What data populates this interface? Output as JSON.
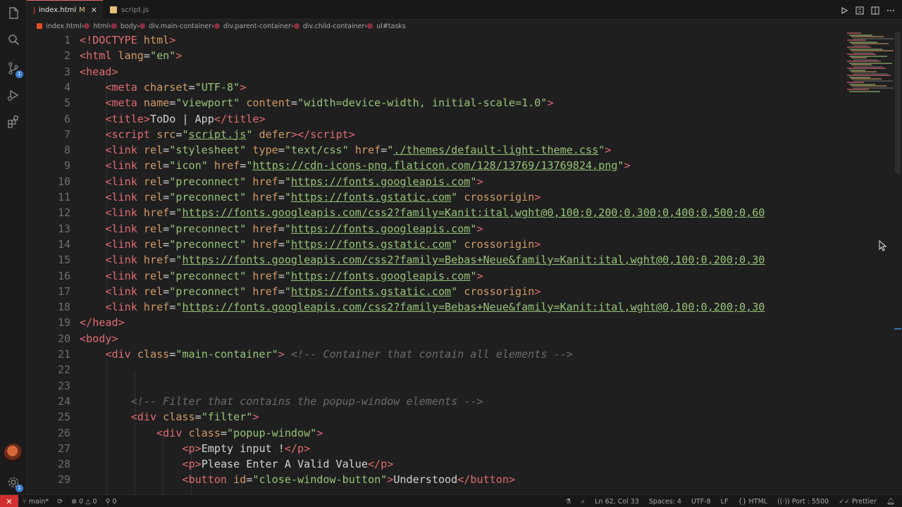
{
  "tabs": [
    {
      "label": "index.html",
      "modified": "M",
      "active": true
    },
    {
      "label": "script.js",
      "active": false
    }
  ],
  "breadcrumb": [
    "index.html",
    "html",
    "body",
    "div.main-container",
    "div.parent-container",
    "div.child-container",
    "ul#tasks"
  ],
  "line_numbers": [
    "1",
    "2",
    "3",
    "4",
    "5",
    "6",
    "7",
    "8",
    "9",
    "10",
    "11",
    "12",
    "13",
    "14",
    "15",
    "16",
    "17",
    "18",
    "19",
    "20",
    "21",
    "22",
    "23",
    "24",
    "25",
    "26",
    "27",
    "28",
    "29"
  ],
  "code_lines": [
    [
      [
        "br",
        "<!"
      ],
      [
        "tag",
        "DOCTYPE"
      ],
      [
        "txt",
        " "
      ],
      [
        "at",
        "html"
      ],
      [
        "br",
        ">"
      ]
    ],
    [
      [
        "br",
        "<"
      ],
      [
        "tag",
        "html"
      ],
      [
        "txt",
        " "
      ],
      [
        "at",
        "lang"
      ],
      [
        "txt",
        "="
      ],
      [
        "st",
        "\"en\""
      ],
      [
        "br",
        ">"
      ]
    ],
    [
      [
        "br",
        "<"
      ],
      [
        "tag",
        "head"
      ],
      [
        "br",
        ">"
      ]
    ],
    [
      [
        "txt",
        "    "
      ],
      [
        "br",
        "<"
      ],
      [
        "tag",
        "meta"
      ],
      [
        "txt",
        " "
      ],
      [
        "at",
        "charset"
      ],
      [
        "txt",
        "="
      ],
      [
        "st",
        "\"UTF-8\""
      ],
      [
        "br",
        ">"
      ]
    ],
    [
      [
        "txt",
        "    "
      ],
      [
        "br",
        "<"
      ],
      [
        "tag",
        "meta"
      ],
      [
        "txt",
        " "
      ],
      [
        "at",
        "name"
      ],
      [
        "txt",
        "="
      ],
      [
        "st",
        "\"viewport\""
      ],
      [
        "txt",
        " "
      ],
      [
        "at",
        "content"
      ],
      [
        "txt",
        "="
      ],
      [
        "st",
        "\"width=device-width, initial-scale=1.0\""
      ],
      [
        "br",
        ">"
      ]
    ],
    [
      [
        "txt",
        "    "
      ],
      [
        "br",
        "<"
      ],
      [
        "tag",
        "title"
      ],
      [
        "br",
        ">"
      ],
      [
        "txt",
        "ToDo | App"
      ],
      [
        "br",
        "</"
      ],
      [
        "tag",
        "title"
      ],
      [
        "br",
        ">"
      ]
    ],
    [
      [
        "txt",
        "    "
      ],
      [
        "br",
        "<"
      ],
      [
        "tag",
        "script"
      ],
      [
        "txt",
        " "
      ],
      [
        "at",
        "src"
      ],
      [
        "txt",
        "="
      ],
      [
        "st",
        "\""
      ],
      [
        "stu",
        "script.js"
      ],
      [
        "st",
        "\""
      ],
      [
        "txt",
        " "
      ],
      [
        "at",
        "defer"
      ],
      [
        "br",
        "></"
      ],
      [
        "tag",
        "script"
      ],
      [
        "br",
        ">"
      ]
    ],
    [
      [
        "txt",
        "    "
      ],
      [
        "br",
        "<"
      ],
      [
        "tag",
        "link"
      ],
      [
        "txt",
        " "
      ],
      [
        "at",
        "rel"
      ],
      [
        "txt",
        "="
      ],
      [
        "st",
        "\"stylesheet\""
      ],
      [
        "txt",
        " "
      ],
      [
        "at",
        "type"
      ],
      [
        "txt",
        "="
      ],
      [
        "st",
        "\"text/css\""
      ],
      [
        "txt",
        " "
      ],
      [
        "at",
        "href"
      ],
      [
        "txt",
        "="
      ],
      [
        "st",
        "\""
      ],
      [
        "stu",
        "./themes/default-light-theme.css"
      ],
      [
        "st",
        "\""
      ],
      [
        "br",
        ">"
      ]
    ],
    [
      [
        "txt",
        "    "
      ],
      [
        "br",
        "<"
      ],
      [
        "tag",
        "link"
      ],
      [
        "txt",
        " "
      ],
      [
        "at",
        "rel"
      ],
      [
        "txt",
        "="
      ],
      [
        "st",
        "\"icon\""
      ],
      [
        "txt",
        " "
      ],
      [
        "at",
        "href"
      ],
      [
        "txt",
        "="
      ],
      [
        "st",
        "\""
      ],
      [
        "stu",
        "https://cdn-icons-png.flaticon.com/128/13769/13769824.png"
      ],
      [
        "st",
        "\""
      ],
      [
        "br",
        ">"
      ]
    ],
    [
      [
        "txt",
        "    "
      ],
      [
        "br",
        "<"
      ],
      [
        "tag",
        "link"
      ],
      [
        "txt",
        " "
      ],
      [
        "at",
        "rel"
      ],
      [
        "txt",
        "="
      ],
      [
        "st",
        "\"preconnect\""
      ],
      [
        "txt",
        " "
      ],
      [
        "at",
        "href"
      ],
      [
        "txt",
        "="
      ],
      [
        "st",
        "\""
      ],
      [
        "stu",
        "https://fonts.googleapis.com"
      ],
      [
        "st",
        "\""
      ],
      [
        "br",
        ">"
      ]
    ],
    [
      [
        "txt",
        "    "
      ],
      [
        "br",
        "<"
      ],
      [
        "tag",
        "link"
      ],
      [
        "txt",
        " "
      ],
      [
        "at",
        "rel"
      ],
      [
        "txt",
        "="
      ],
      [
        "st",
        "\"preconnect\""
      ],
      [
        "txt",
        " "
      ],
      [
        "at",
        "href"
      ],
      [
        "txt",
        "="
      ],
      [
        "st",
        "\""
      ],
      [
        "stu",
        "https://fonts.gstatic.com"
      ],
      [
        "st",
        "\""
      ],
      [
        "txt",
        " "
      ],
      [
        "at",
        "crossorigin"
      ],
      [
        "br",
        ">"
      ]
    ],
    [
      [
        "txt",
        "    "
      ],
      [
        "br",
        "<"
      ],
      [
        "tag",
        "link"
      ],
      [
        "txt",
        " "
      ],
      [
        "at",
        "href"
      ],
      [
        "txt",
        "="
      ],
      [
        "st",
        "\""
      ],
      [
        "stu",
        "https://fonts.googleapis.com/css2?family=Kanit:ital,wght@0,100;0,200;0,300;0,400;0,500;0,60"
      ]
    ],
    [
      [
        "txt",
        "    "
      ],
      [
        "br",
        "<"
      ],
      [
        "tag",
        "link"
      ],
      [
        "txt",
        " "
      ],
      [
        "at",
        "rel"
      ],
      [
        "txt",
        "="
      ],
      [
        "st",
        "\"preconnect\""
      ],
      [
        "txt",
        " "
      ],
      [
        "at",
        "href"
      ],
      [
        "txt",
        "="
      ],
      [
        "st",
        "\""
      ],
      [
        "stu",
        "https://fonts.googleapis.com"
      ],
      [
        "st",
        "\""
      ],
      [
        "br",
        ">"
      ]
    ],
    [
      [
        "txt",
        "    "
      ],
      [
        "br",
        "<"
      ],
      [
        "tag",
        "link"
      ],
      [
        "txt",
        " "
      ],
      [
        "at",
        "rel"
      ],
      [
        "txt",
        "="
      ],
      [
        "st",
        "\"preconnect\""
      ],
      [
        "txt",
        " "
      ],
      [
        "at",
        "href"
      ],
      [
        "txt",
        "="
      ],
      [
        "st",
        "\""
      ],
      [
        "stu",
        "https://fonts.gstatic.com"
      ],
      [
        "st",
        "\""
      ],
      [
        "txt",
        " "
      ],
      [
        "at",
        "crossorigin"
      ],
      [
        "br",
        ">"
      ]
    ],
    [
      [
        "txt",
        "    "
      ],
      [
        "br",
        "<"
      ],
      [
        "tag",
        "link"
      ],
      [
        "txt",
        " "
      ],
      [
        "at",
        "href"
      ],
      [
        "txt",
        "="
      ],
      [
        "st",
        "\""
      ],
      [
        "stu",
        "https://fonts.googleapis.com/css2?family=Bebas+Neue&family=Kanit:ital,wght@0,100;0,200;0,30"
      ]
    ],
    [
      [
        "txt",
        "    "
      ],
      [
        "br",
        "<"
      ],
      [
        "tag",
        "link"
      ],
      [
        "txt",
        " "
      ],
      [
        "at",
        "rel"
      ],
      [
        "txt",
        "="
      ],
      [
        "st",
        "\"preconnect\""
      ],
      [
        "txt",
        " "
      ],
      [
        "at",
        "href"
      ],
      [
        "txt",
        "="
      ],
      [
        "st",
        "\""
      ],
      [
        "stu",
        "https://fonts.googleapis.com"
      ],
      [
        "st",
        "\""
      ],
      [
        "br",
        ">"
      ]
    ],
    [
      [
        "txt",
        "    "
      ],
      [
        "br",
        "<"
      ],
      [
        "tag",
        "link"
      ],
      [
        "txt",
        " "
      ],
      [
        "at",
        "rel"
      ],
      [
        "txt",
        "="
      ],
      [
        "st",
        "\"preconnect\""
      ],
      [
        "txt",
        " "
      ],
      [
        "at",
        "href"
      ],
      [
        "txt",
        "="
      ],
      [
        "st",
        "\""
      ],
      [
        "stu",
        "https://fonts.gstatic.com"
      ],
      [
        "st",
        "\""
      ],
      [
        "txt",
        " "
      ],
      [
        "at",
        "crossorigin"
      ],
      [
        "br",
        ">"
      ]
    ],
    [
      [
        "txt",
        "    "
      ],
      [
        "br",
        "<"
      ],
      [
        "tag",
        "link"
      ],
      [
        "txt",
        " "
      ],
      [
        "at",
        "href"
      ],
      [
        "txt",
        "="
      ],
      [
        "st",
        "\""
      ],
      [
        "stu",
        "https://fonts.googleapis.com/css2?family=Bebas+Neue&family=Kanit:ital,wght@0,100;0,200;0,30"
      ]
    ],
    [
      [
        "br",
        "</"
      ],
      [
        "tag",
        "head"
      ],
      [
        "br",
        ">"
      ]
    ],
    [
      [
        "br",
        "<"
      ],
      [
        "tag",
        "body"
      ],
      [
        "br",
        ">"
      ]
    ],
    [
      [
        "txt",
        "    "
      ],
      [
        "br",
        "<"
      ],
      [
        "tag",
        "div"
      ],
      [
        "txt",
        " "
      ],
      [
        "at",
        "class"
      ],
      [
        "txt",
        "="
      ],
      [
        "st",
        "\"main-container\""
      ],
      [
        "br",
        ">"
      ],
      [
        "txt",
        " "
      ],
      [
        "cm",
        "<!-- Container that contain all elements -->"
      ]
    ],
    [
      [
        "txt",
        ""
      ]
    ],
    [
      [
        "txt",
        ""
      ]
    ],
    [
      [
        "txt",
        "        "
      ],
      [
        "cm",
        "<!-- Filter that contains the popup-window elements -->"
      ]
    ],
    [
      [
        "txt",
        "        "
      ],
      [
        "br",
        "<"
      ],
      [
        "tag",
        "div"
      ],
      [
        "txt",
        " "
      ],
      [
        "at",
        "class"
      ],
      [
        "txt",
        "="
      ],
      [
        "st",
        "\"filter\""
      ],
      [
        "br",
        ">"
      ]
    ],
    [
      [
        "txt",
        "            "
      ],
      [
        "br",
        "<"
      ],
      [
        "tag",
        "div"
      ],
      [
        "txt",
        " "
      ],
      [
        "at",
        "class"
      ],
      [
        "txt",
        "="
      ],
      [
        "st",
        "\"popup-window\""
      ],
      [
        "br",
        ">"
      ]
    ],
    [
      [
        "txt",
        "                "
      ],
      [
        "br",
        "<"
      ],
      [
        "tag",
        "p"
      ],
      [
        "br",
        ">"
      ],
      [
        "txt",
        "Empty input !"
      ],
      [
        "br",
        "</"
      ],
      [
        "tag",
        "p"
      ],
      [
        "br",
        ">"
      ]
    ],
    [
      [
        "txt",
        "                "
      ],
      [
        "br",
        "<"
      ],
      [
        "tag",
        "p"
      ],
      [
        "br",
        ">"
      ],
      [
        "txt",
        "Please Enter A Valid Value"
      ],
      [
        "br",
        "</"
      ],
      [
        "tag",
        "p"
      ],
      [
        "br",
        ">"
      ]
    ],
    [
      [
        "txt",
        "                "
      ],
      [
        "br",
        "<"
      ],
      [
        "tag",
        "button"
      ],
      [
        "txt",
        " "
      ],
      [
        "at",
        "id"
      ],
      [
        "txt",
        "="
      ],
      [
        "st",
        "\"close-window-button\""
      ],
      [
        "br",
        ">"
      ],
      [
        "txt",
        "Understood"
      ],
      [
        "br",
        "</"
      ],
      [
        "tag",
        "button"
      ],
      [
        "br",
        ">"
      ]
    ]
  ],
  "status": {
    "branch": "main*",
    "errors": "0",
    "warnings": "0",
    "ports": "0",
    "cursor": "Ln 62, Col 33",
    "spaces": "Spaces: 4",
    "encoding": "UTF-8",
    "eol": "LF",
    "language": "HTML",
    "port": "Port : 5500",
    "formatter": "Prettier"
  },
  "colors": {
    "accent_remote": "#d03030",
    "tag": "#e06c75",
    "attribute": "#d19a66",
    "string": "#98c379",
    "comment": "#6b6b6b"
  }
}
